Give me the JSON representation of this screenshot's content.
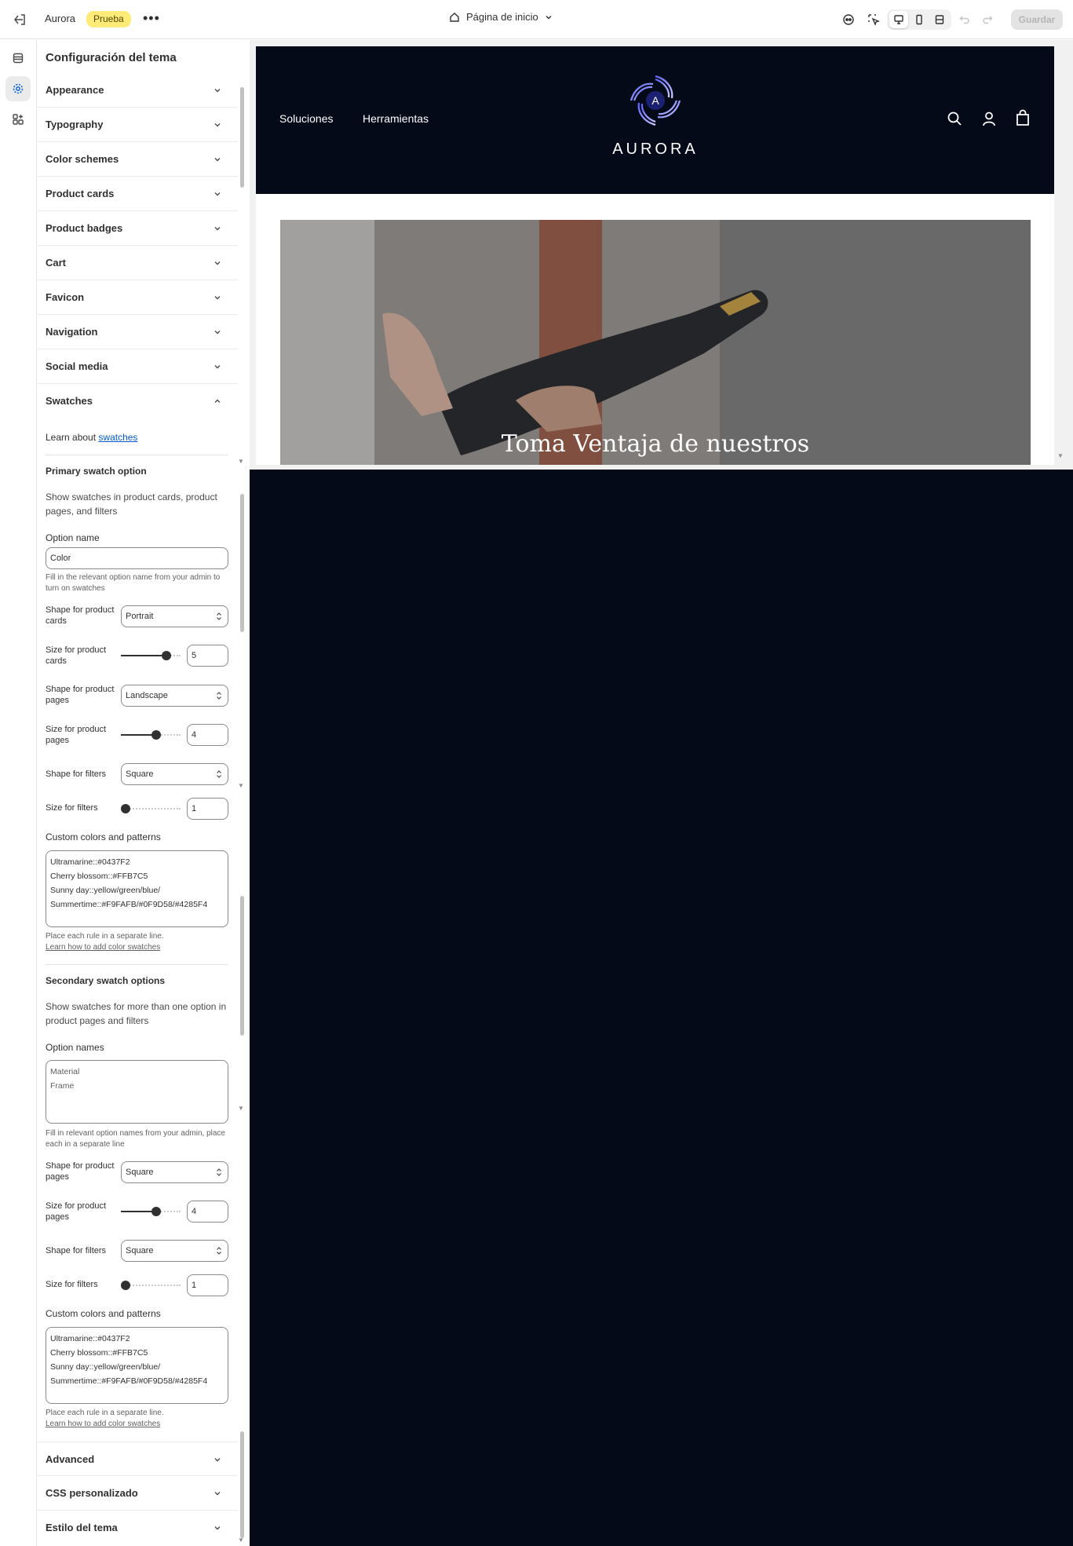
{
  "topbar": {
    "store_name": "Aurora",
    "badge": "Prueba",
    "more_glyph": "•••",
    "page_selector": "Página de inicio",
    "save_label": "Guardar"
  },
  "rail": {
    "items": [
      "sections-icon",
      "theme-settings-icon",
      "apps-icon"
    ],
    "active": "theme-settings-icon"
  },
  "panel": {
    "title": "Configuración del tema",
    "sections_top": [
      "Appearance",
      "Typography",
      "Color schemes",
      "Product cards",
      "Product badges",
      "Cart",
      "Favicon",
      "Navigation",
      "Social media"
    ],
    "swatches": {
      "title": "Swatches",
      "learn_prefix": "Learn about",
      "learn_link": "swatches",
      "primary": {
        "heading": "Primary swatch option",
        "description": "Show swatches in product cards, product pages, and filters",
        "option_name_label": "Option name",
        "option_name_value": "Color",
        "option_name_hint": "Fill in the relevant option name from your admin to turn on swatches",
        "shape_cards_label": "Shape for product cards",
        "shape_cards_value": "Portrait",
        "size_cards_label": "Size for product cards",
        "size_cards_value": "5",
        "shape_pages_label": "Shape for product pages",
        "shape_pages_value": "Landscape",
        "size_pages_label": "Size for product pages",
        "size_pages_value": "4",
        "shape_filters_label": "Shape for filters",
        "shape_filters_value": "Square",
        "size_filters_label": "Size for filters",
        "size_filters_value": "1",
        "custom_label": "Custom colors and patterns",
        "custom_value": "Ultramarine::#0437F2\nCherry blossom::#FFB7C5\nSunny day::yellow/green/blue/\nSummertime::#F9FAFB/#0F9D58/#4285F4",
        "custom_hint": "Place each rule in a separate line.",
        "custom_link": "Learn how to add color swatches"
      },
      "secondary": {
        "heading": "Secondary swatch options",
        "description": "Show swatches for more than one option in product pages and filters",
        "option_names_label": "Option names",
        "option_names_value": "Material\nFrame",
        "option_names_hint": "Fill in relevant option names from your admin, place each in a separate line",
        "shape_pages_label": "Shape for product pages",
        "shape_pages_value": "Square",
        "size_pages_label": "Size for product pages",
        "size_pages_value": "4",
        "shape_filters_label": "Shape for filters",
        "shape_filters_value": "Square",
        "size_filters_label": "Size for filters",
        "size_filters_value": "1",
        "custom_label": "Custom colors and patterns",
        "custom_value": "Ultramarine::#0437F2\nCherry blossom::#FFB7C5\nSunny day::yellow/green/blue/\nSummertime::#F9FAFB/#0F9D58/#4285F4",
        "custom_hint": "Place each rule in a separate line.",
        "custom_link": "Learn how to add color swatches"
      }
    },
    "sections_bottom": [
      "Advanced",
      "CSS personalizado",
      "Estilo del tema"
    ]
  },
  "preview": {
    "nav": [
      "Soluciones",
      "Herramientas"
    ],
    "logo_letter": "A",
    "logo_text": "AURORA",
    "hero_text": "Toma Ventaja de nuestros",
    "header_icons": [
      "search-icon",
      "account-icon",
      "cart-icon"
    ],
    "colors": {
      "header_bg": "#050a18",
      "accent": "#1f6fd1",
      "badge_bg": "#ffeb78"
    }
  }
}
